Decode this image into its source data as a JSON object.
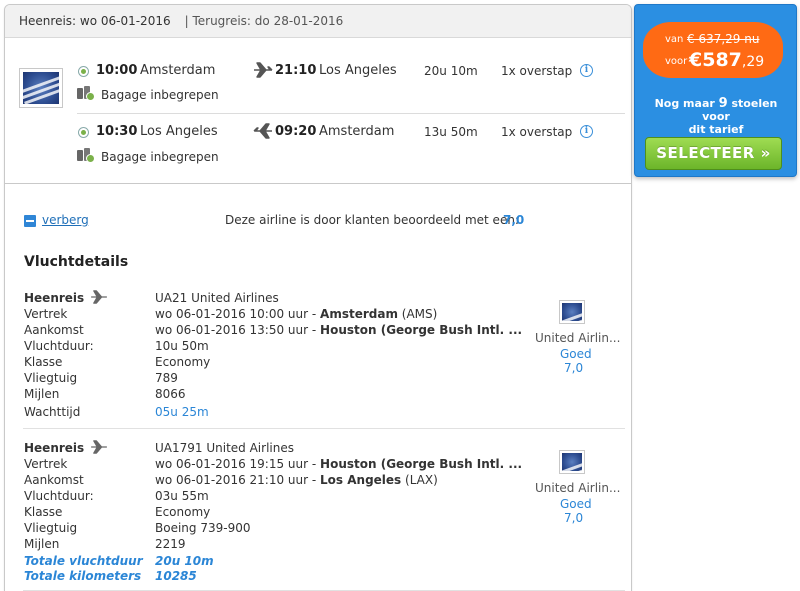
{
  "header": {
    "outbound": "Heenreis: wo 06-01-2016",
    "return": "| Terugreis: do 28-01-2016"
  },
  "legs": [
    {
      "dep_time": "10:00",
      "dep_city": "Amsterdam",
      "arr_time": "21:10",
      "arr_city": "Los Angeles",
      "duration": "20u 10m",
      "stops": "1x overstap",
      "baggage": "Bagage inbegrepen"
    },
    {
      "dep_time": "10:30",
      "dep_city": "Los Angeles",
      "arr_time": "09:20",
      "arr_city": "Amsterdam",
      "duration": "13u 50m",
      "stops": "1x overstap",
      "baggage": "Bagage inbegrepen"
    }
  ],
  "rating_bar": {
    "toggle": "verberg",
    "text": "Deze airline is door klanten beoordeeld met een:",
    "score": "7,0"
  },
  "details": {
    "title": "Vluchtdetails",
    "segments": [
      {
        "label": "Heenreis",
        "flight": "UA21 United Airlines",
        "rows": [
          {
            "label": "Vertrek",
            "pre": "wo 06-01-2016 10:00 uur - ",
            "strong": "Amsterdam",
            "post": " (AMS)"
          },
          {
            "label": "Aankomst",
            "pre": "wo 06-01-2016 13:50 uur - ",
            "strong": "Houston (George Bush Intl. ...",
            "post": ""
          },
          {
            "label": "Vluchtduur:",
            "pre": "10u 50m",
            "strong": "",
            "post": ""
          },
          {
            "label": "Klasse",
            "pre": "Economy",
            "strong": "",
            "post": ""
          },
          {
            "label": "Vliegtuig",
            "pre": "789",
            "strong": "",
            "post": ""
          },
          {
            "label": "Mijlen",
            "pre": "8066",
            "strong": "",
            "post": ""
          }
        ],
        "wait_label": "Wachttijd",
        "wait_value": "05u 25m",
        "airline_name": "United Airlin...",
        "airline_rating_word": "Goed",
        "airline_rating": "7,0"
      },
      {
        "label": "Heenreis",
        "flight": "UA1791 United Airlines",
        "rows": [
          {
            "label": "Vertrek",
            "pre": "wo 06-01-2016 19:15 uur - ",
            "strong": "Houston (George Bush Intl. ...",
            "post": ""
          },
          {
            "label": "Aankomst",
            "pre": "wo 06-01-2016 21:10 uur - ",
            "strong": "Los Angeles",
            "post": " (LAX)"
          },
          {
            "label": "Vluchtduur:",
            "pre": "03u 55m",
            "strong": "",
            "post": ""
          },
          {
            "label": "Klasse",
            "pre": "Economy",
            "strong": "",
            "post": ""
          },
          {
            "label": "Vliegtuig",
            "pre": "Boeing 739-900",
            "strong": "",
            "post": ""
          },
          {
            "label": "Mijlen",
            "pre": "2219",
            "strong": "",
            "post": ""
          }
        ],
        "airline_name": "United Airlin...",
        "airline_rating_word": "Goed",
        "airline_rating": "7,0"
      }
    ],
    "totals": [
      {
        "label": "Totale vluchtduur",
        "value": "20u 10m"
      },
      {
        "label": "Totale kilometers",
        "value": "10285"
      }
    ]
  },
  "price": {
    "old_prefix": "van",
    "old_price": "€ 637,29 nu",
    "new_prefix": "voor",
    "new_price": "€587",
    "new_cents": ",29",
    "seats_line1_pre": "Nog maar ",
    "seats_count": "9",
    "seats_line1_post": " stoelen voor",
    "seats_line2": "dit tarief",
    "select_label": "SELECTEER »"
  },
  "colors": {
    "accent_blue": "#2b86d6",
    "price_orange": "#ff6a14",
    "select_green": "#6cb52a",
    "sidebar_blue": "#2b8fe2"
  }
}
